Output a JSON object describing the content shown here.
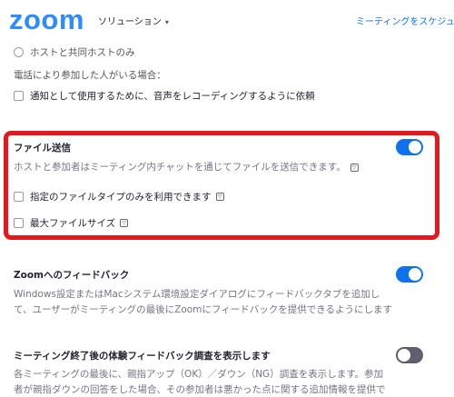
{
  "header": {
    "logo": "zoom",
    "solutions_label": "ソリューション",
    "caret": "▾",
    "schedule_label": "ミーティングをスケジュール"
  },
  "settings": {
    "host_cohost_option": "ホストと共同ホストのみ",
    "phone_participant_heading": "電話により参加した人がいる場合：",
    "notify_recording_label": "通知として使用するために、音声をレコーディングするように依頼",
    "file_transfer": {
      "title": "ファイル送信",
      "description": "ホストと参加者はミーティング内チャットを通じてファイルを送信できます。",
      "info_icon": "info-icon",
      "enabled": true,
      "restrict_types_label": "指定のファイルタイプのみを利用できます",
      "max_size_label": "最大ファイルサイズ"
    },
    "feedback_to_zoom": {
      "title": "Zoomへのフィードバック",
      "description_line1": "Windows設定またはMacシステム環境設定ダイアログにフィードバックタブを追加し",
      "description_line2": "て、ユーザーがミーティングの最後にZoomにフィードバックを提供できるようにします",
      "enabled": true
    },
    "end_meeting_survey": {
      "title": "ミーティング終了後の体験フィードバック調査を表示します",
      "description_line1": "各ミーティングの最後に、親指アップ（OK）／ダウン（NG）調査を表示します。参加",
      "description_line2": "者が親指ダウンの回答をした場合、その参加者は悪かった点に関する追加情報を提供で",
      "enabled": false
    }
  },
  "colors": {
    "brand": "#2D8CFF",
    "link": "#0E72ED",
    "toggle_on": "#0E72ED",
    "toggle_off": "#5F5F6E",
    "highlight": "#E5181D"
  }
}
